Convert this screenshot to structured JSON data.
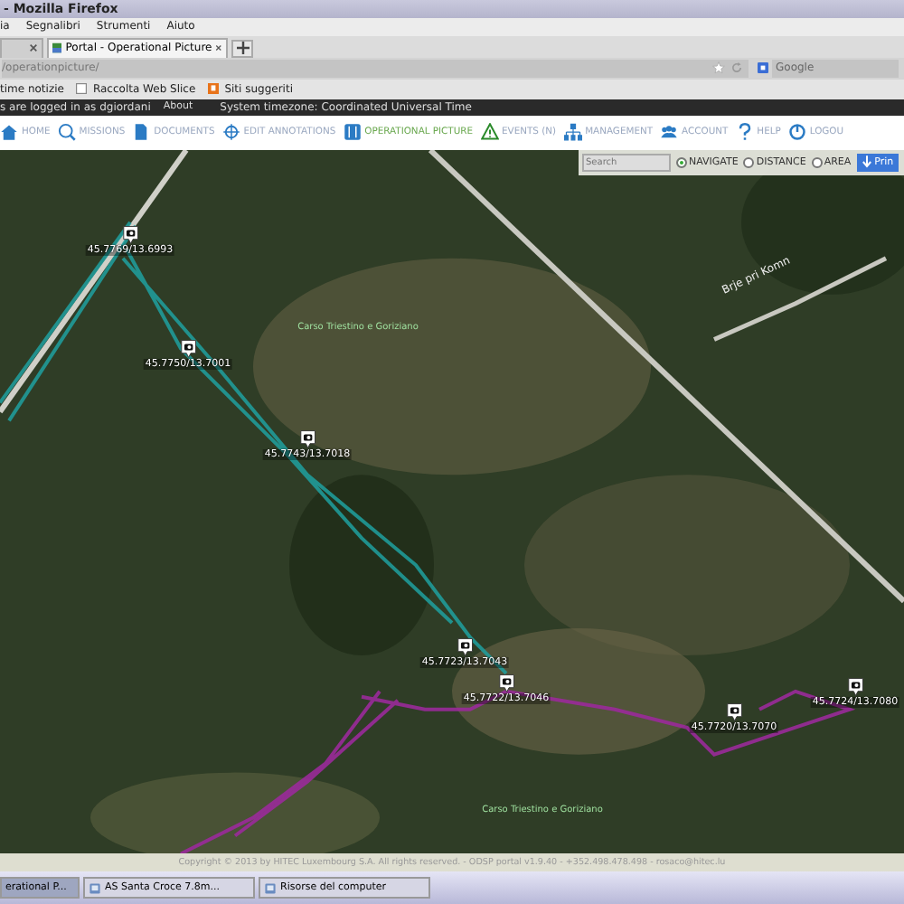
{
  "window": {
    "title": "- Mozilla Firefox"
  },
  "menu": [
    "ia",
    "Segnalibri",
    "Strumenti",
    "Aiuto"
  ],
  "tabs": [
    {
      "label": "Portal - Operational Picture",
      "selected": true
    }
  ],
  "address": {
    "value": "/operationpicture/"
  },
  "web_search": {
    "placeholder": "Google"
  },
  "bookmarks": [
    "time notizie",
    "Raccolta Web Slice",
    "Siti suggeriti"
  ],
  "status_bar": {
    "user": "s are logged in as dgiordani",
    "about": "About",
    "timezone": "System timezone: Coordinated Universal Time"
  },
  "nav": [
    {
      "label": "HOME",
      "selected": false
    },
    {
      "label": "MISSIONS",
      "selected": false
    },
    {
      "label": "DOCUMENTS",
      "selected": false
    },
    {
      "label": "EDIT ANNOTATIONS",
      "selected": false
    },
    {
      "label": "OPERATIONAL PICTURE",
      "selected": true
    },
    {
      "label": "EVENTS (N)",
      "selected": false
    },
    {
      "label": "MANAGEMENT",
      "selected": false
    },
    {
      "label": "ACCOUNT",
      "selected": false
    },
    {
      "label": "HELP",
      "selected": false
    },
    {
      "label": "LOGOU",
      "selected": false
    }
  ],
  "map_tools": {
    "search_placeholder": "Search",
    "modes": [
      {
        "label": "NAVIGATE",
        "selected": true
      },
      {
        "label": "DISTANCE",
        "selected": false
      },
      {
        "label": "AREA",
        "selected": false
      }
    ],
    "print": "Prin"
  },
  "map_labels": [
    "Carso Triestino e Goriziano",
    "Carso Triestino e Goriziano"
  ],
  "road_label": {
    "text": "Brje pri Komn"
  },
  "markers": [
    "45.7769/13.6993",
    "45.7750/13.7001",
    "45.7743/13.7018",
    "45.7723/13.7043",
    "45.7722/13.7046",
    "45.7720/13.7070",
    "45.7724/13.7080"
  ],
  "footer": "Copyright © 2013 by HITEC Luxembourg S.A. All rights reserved. - ODSP portal v1.9.40 - +352.498.478.498 - rosaco@hitec.lu",
  "taskbar": [
    {
      "label": "erational P...",
      "selected": true
    },
    {
      "label": "AS Santa Croce 7.8m...",
      "selected": false
    },
    {
      "label": "Risorse del computer",
      "selected": false
    }
  ]
}
